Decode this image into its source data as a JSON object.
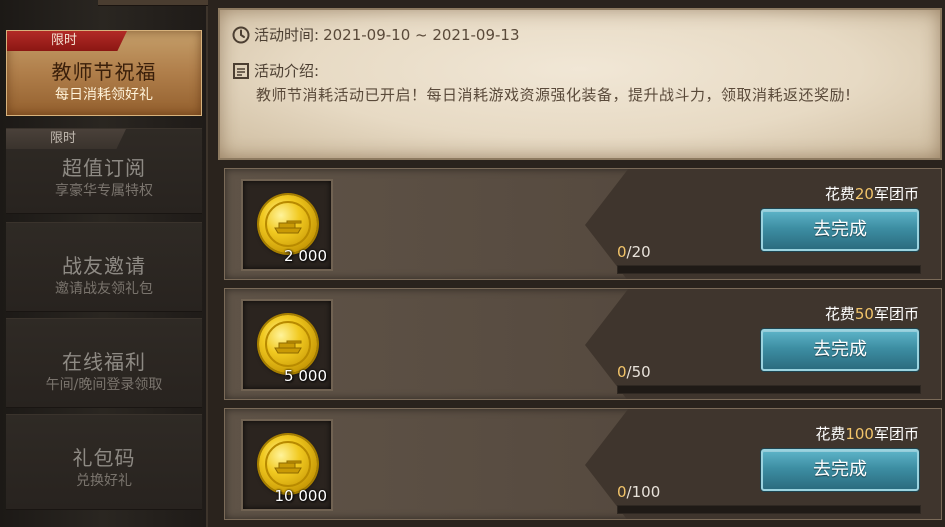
{
  "sidebar": {
    "items": [
      {
        "badge": "限时",
        "title": "教师节祝福",
        "sub": "每日消耗领好礼",
        "active": true
      },
      {
        "badge": "限时",
        "title": "超值订阅",
        "sub": "享豪华专属特权",
        "active": false
      },
      {
        "badge": "",
        "title": "战友邀请",
        "sub": "邀请战友领礼包",
        "active": false
      },
      {
        "badge": "",
        "title": "在线福利",
        "sub": "午间/晚间登录领取",
        "active": false
      },
      {
        "badge": "",
        "title": "礼包码",
        "sub": "兑换好礼",
        "active": false
      }
    ]
  },
  "info": {
    "time_label": "活动时间:",
    "time_value": "2021-09-10 ~ 2021-09-13",
    "desc_label": "活动介绍:",
    "desc_text": "教师节消耗活动已开启！每日消耗游戏资源强化装备，提升战斗力，领取消耗返还奖励!"
  },
  "tasks": [
    {
      "reward_amount": "2 000",
      "cost_prefix": "花费",
      "cost_num": "20",
      "cost_suffix": "军团币",
      "button": "去完成",
      "progress_current": "0",
      "progress_total": "/20",
      "progress_fraction": 0
    },
    {
      "reward_amount": "5 000",
      "cost_prefix": "花费",
      "cost_num": "50",
      "cost_suffix": "军团币",
      "button": "去完成",
      "progress_current": "0",
      "progress_total": "/50",
      "progress_fraction": 0
    },
    {
      "reward_amount": "10 000",
      "cost_prefix": "花费",
      "cost_num": "100",
      "cost_suffix": "军团币",
      "button": "去完成",
      "progress_current": "0",
      "progress_total": "/100",
      "progress_fraction": 0
    }
  ],
  "colors": {
    "accent_gold": "#f2c46a",
    "badge_red": "#b22b26",
    "button_teal": "#3d8ea3"
  },
  "icons": {
    "time": "clock-icon",
    "desc": "document-icon",
    "reward": "gold-coin-tank-icon"
  }
}
